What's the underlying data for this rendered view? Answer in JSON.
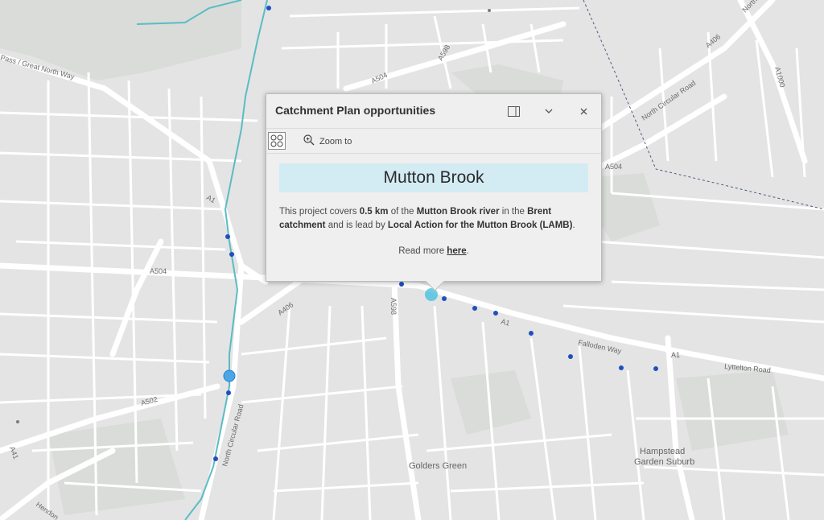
{
  "map": {
    "road_labels": [
      "A1",
      "A504",
      "A406",
      "A598",
      "A502",
      "A41",
      "A1000",
      "A504",
      "A598",
      "A406",
      "A504"
    ],
    "street_labels": {
      "north_circular_ne": "North Circular Road",
      "north_circular_sw": "North Circular Road",
      "falloden": "Falloden Way",
      "lyttelton": "Lyttelton Road",
      "great_north_way": "Pass / Great North Way",
      "a1_falloden": "A1",
      "a1_lyttelton": "A1",
      "hendon": "Hendon",
      "nort_ne": "North"
    },
    "places": {
      "golders_green": "Golders Green",
      "hampstead_1": "Hampstead",
      "hampstead_2": "Garden Suburb"
    }
  },
  "popup": {
    "title": "Catchment Plan opportunities",
    "zoom_to_label": "Zoom to",
    "feature_title": "Mutton Brook",
    "description": {
      "t1": "This project covers ",
      "b1": "0.5 km",
      "t2": " of the ",
      "b2": "Mutton Brook river",
      "t3": " in the ",
      "b3": "Brent catchment",
      "t4": " and is lead by ",
      "b4": "Local Action for the Mutton Brook (LAMB)",
      "t5": "."
    },
    "read_more_prefix": "Read more ",
    "read_more_link": "here",
    "read_more_suffix": "."
  },
  "colors": {
    "map_background": "#e3e3e3",
    "road": "#ffffff",
    "river": "#5bbcc4",
    "point": "#1f4fbf",
    "selected_point": "#4aa6e8",
    "popup_title_bg": "#d3ecf4"
  },
  "icons": [
    "dock-icon",
    "chevron-down-icon",
    "close-icon",
    "feature-menu-icon",
    "zoom-in-icon"
  ]
}
